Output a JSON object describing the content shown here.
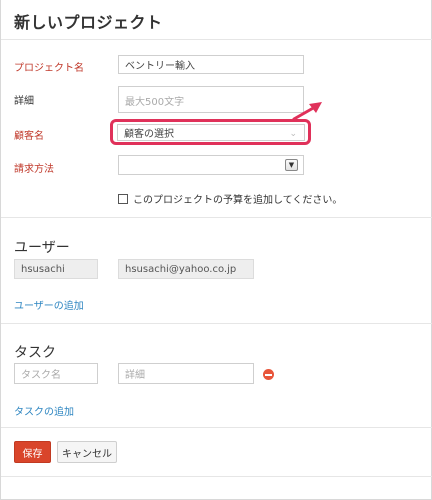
{
  "page": {
    "title": "新しいプロジェクト"
  },
  "form": {
    "project_name": {
      "label": "プロジェクト名",
      "value": "ベントリー輸入"
    },
    "details": {
      "label": "詳細",
      "placeholder": "最大500文字"
    },
    "customer": {
      "label": "顧客名",
      "selected": "顧客の選択"
    },
    "billing": {
      "label": "請求方法",
      "selected": ""
    },
    "budget_checkbox": {
      "label": "このプロジェクトの予算を追加してください。",
      "checked": false
    }
  },
  "users": {
    "heading": "ユーザー",
    "rows": [
      {
        "name": "hsusachi",
        "email": "hsusachi@yahoo.co.jp"
      }
    ],
    "add_link": "ユーザーの追加"
  },
  "tasks": {
    "heading": "タスク",
    "name_placeholder": "タスク名",
    "details_placeholder": "詳細",
    "add_link": "タスクの追加"
  },
  "actions": {
    "save": "保存",
    "cancel": "キャンセル"
  },
  "colors": {
    "accent_red": "#d9452b",
    "required_label": "#c0392b",
    "link": "#2e86c1",
    "highlight": "#e0315a"
  },
  "icons": {
    "customer_dropdown": "chevron-down-icon",
    "billing_dropdown": "dropdown-arrow-icon",
    "remove_task": "minus-circle-icon"
  }
}
